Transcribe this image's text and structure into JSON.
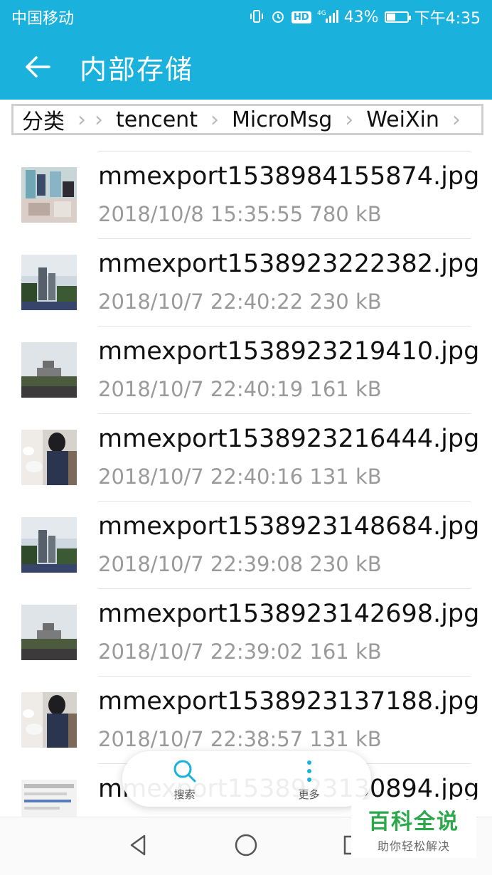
{
  "status_bar": {
    "carrier": "中国移动",
    "hd": "HD",
    "network": "4G",
    "battery_percent": "43%",
    "battery_level": 0.43,
    "time": "下午4:35"
  },
  "app_bar": {
    "title": "内部存储"
  },
  "breadcrumb": [
    "分类",
    "tencent",
    "MicroMsg",
    "WeiXin"
  ],
  "files": [
    {
      "name": "mmexport1538984155874.jpg",
      "meta": "2018/10/8 15:35:55 780 kB",
      "thumb": "products"
    },
    {
      "name": "mmexport1538923222382.jpg",
      "meta": "2018/10/7 22:40:22 230 kB",
      "thumb": "tower-trees"
    },
    {
      "name": "mmexport1538923219410.jpg",
      "meta": "2018/10/7 22:40:19 161 kB",
      "thumb": "tower-crowd"
    },
    {
      "name": "mmexport1538923216444.jpg",
      "meta": "2018/10/7 22:40:16 131 kB",
      "thumb": "boy-pigeons"
    },
    {
      "name": "mmexport1538923148684.jpg",
      "meta": "2018/10/7 22:39:08 230 kB",
      "thumb": "tower-trees"
    },
    {
      "name": "mmexport1538923142698.jpg",
      "meta": "2018/10/7 22:39:02 161 kB",
      "thumb": "tower-crowd"
    },
    {
      "name": "mmexport1538923137188.jpg",
      "meta": "2018/10/7 22:38:57 131 kB",
      "thumb": "boy-pigeons"
    },
    {
      "name": "mmexport1538923130894.jpg",
      "meta": "",
      "thumb": "document"
    }
  ],
  "floating_bar": {
    "search_label": "搜索",
    "more_label": "更多"
  },
  "watermark": {
    "main": "百科全说",
    "sub": "助你轻松解决"
  },
  "colors": {
    "accent": "#1ab2dc",
    "watermark_green": "#2aa84a"
  }
}
